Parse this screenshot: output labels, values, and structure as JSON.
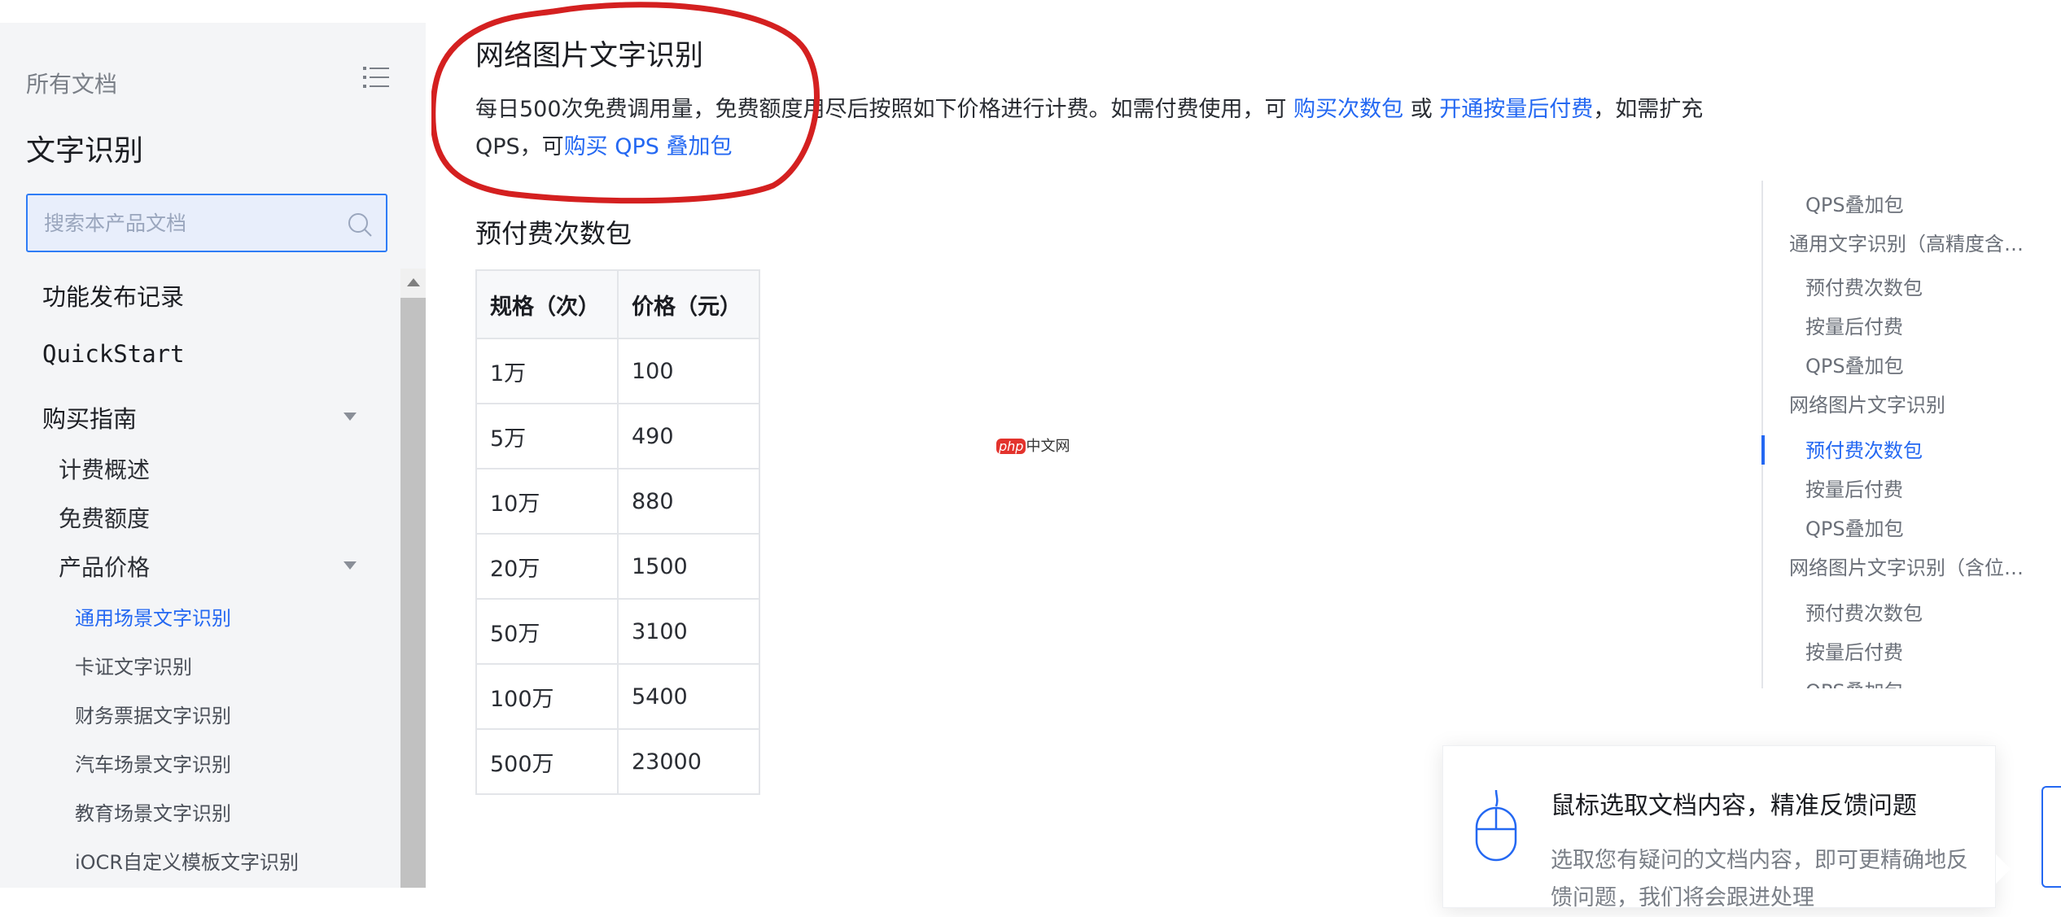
{
  "sidebar": {
    "top_label": "所有文档",
    "title": "文字识别",
    "search_placeholder": "搜索本产品文档",
    "items": [
      {
        "label": "功能发布记录"
      },
      {
        "label": "QuickStart"
      },
      {
        "label": "购买指南"
      },
      {
        "label": "计费概述"
      },
      {
        "label": "免费额度"
      },
      {
        "label": "产品价格"
      },
      {
        "label": "通用场景文字识别"
      },
      {
        "label": "卡证文字识别"
      },
      {
        "label": "财务票据文字识别"
      },
      {
        "label": "汽车场景文字识别"
      },
      {
        "label": "教育场景文字识别"
      },
      {
        "label": "iOCR自定义模板文字识别"
      }
    ]
  },
  "main": {
    "title": "网络图片文字识别",
    "desc_1": "每日500次免费调用量，免费额度用尽后按照如下价格进行计费。如需付费使用，可 ",
    "link_1": "购买次数包",
    "desc_2": " 或 ",
    "link_2": "开通按量后付费",
    "desc_3": "，如需扩充 QPS，可",
    "link_3": "购买 QPS 叠加包",
    "subtitle": "预付费次数包",
    "table": {
      "headers": [
        "规格（次）",
        "价格（元）"
      ],
      "rows": [
        [
          "1万",
          "100"
        ],
        [
          "5万",
          "490"
        ],
        [
          "10万",
          "880"
        ],
        [
          "20万",
          "1500"
        ],
        [
          "50万",
          "3100"
        ],
        [
          "100万",
          "5400"
        ],
        [
          "500万",
          "23000"
        ]
      ]
    },
    "watermark_php": "php",
    "watermark_text": "中文网"
  },
  "toc": {
    "items": [
      {
        "label": "QPS叠加包"
      },
      {
        "label": "通用文字识别（高精度含位置版）"
      },
      {
        "label": "预付费次数包"
      },
      {
        "label": "按量后付费"
      },
      {
        "label": "QPS叠加包"
      },
      {
        "label": "网络图片文字识别"
      },
      {
        "label": "预付费次数包"
      },
      {
        "label": "按量后付费"
      },
      {
        "label": "QPS叠加包"
      },
      {
        "label": "网络图片文字识别（含位置版）"
      },
      {
        "label": "预付费次数包"
      },
      {
        "label": "按量后付费"
      },
      {
        "label": "QPS叠加包"
      }
    ]
  },
  "feedback": {
    "title": "鼠标选取文档内容，精准反馈问题",
    "text": "选取您有疑问的文档内容，即可更精确地反馈问题，我们将会跟进处理"
  },
  "colors": {
    "accent": "#2468f2",
    "annotation": "#d42020"
  }
}
